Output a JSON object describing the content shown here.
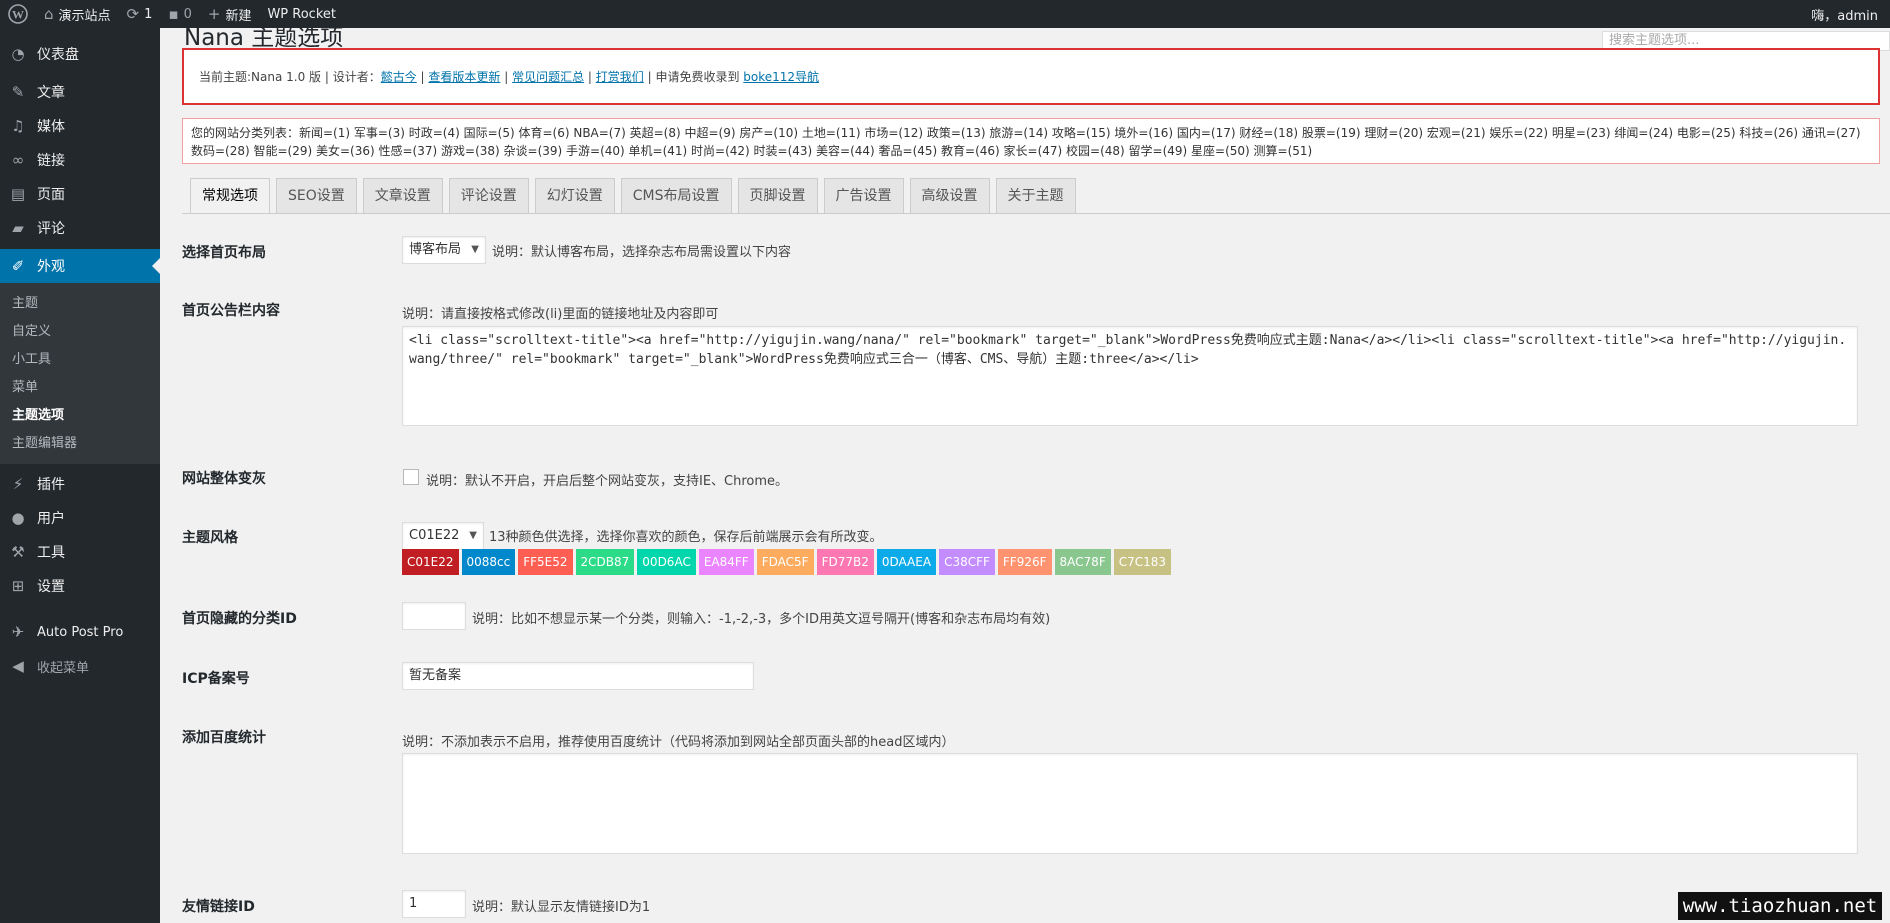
{
  "adminbar": {
    "site_name": "演示站点",
    "updates_count": "1",
    "comments_count": "0",
    "new_label": "新建",
    "rocket_label": "WP Rocket",
    "greeting": "嗨，admin"
  },
  "sidebar": {
    "items": [
      {
        "label": "仪表盘",
        "icon": "dashboard-icon"
      },
      {
        "label": "文章",
        "icon": "pin-icon"
      },
      {
        "label": "媒体",
        "icon": "media-icon"
      },
      {
        "label": "链接",
        "icon": "link-icon"
      },
      {
        "label": "页面",
        "icon": "page-icon"
      },
      {
        "label": "评论",
        "icon": "comment-icon"
      },
      {
        "label": "外观",
        "icon": "brush-icon"
      },
      {
        "label": "插件",
        "icon": "plugin-icon"
      },
      {
        "label": "用户",
        "icon": "user-icon"
      },
      {
        "label": "工具",
        "icon": "wrench-icon"
      },
      {
        "label": "设置",
        "icon": "settings-icon"
      },
      {
        "label": "Auto Post Pro",
        "icon": "auto-post-icon"
      },
      {
        "label": "收起菜单",
        "icon": "collapse-icon"
      }
    ],
    "appearance_submenu": [
      "主题",
      "自定义",
      "小工具",
      "菜单",
      "主题选项",
      "主题编辑器"
    ]
  },
  "page": {
    "title": "Nana 主题选项",
    "search_placeholder": "搜索主题选项..."
  },
  "notice": {
    "prefix": "当前主题:Nana 1.0 版 | 设计者：",
    "designer_link": "懿古今",
    "sep1": " | ",
    "update_link": "查看版本更新",
    "sep2": " | ",
    "faq_link": "常见问题汇总",
    "sep3": " | ",
    "donate_link": "打赏我们",
    "middle": " | 申请免费收录到 ",
    "nav_link": "boke112导航"
  },
  "categories_text": "您的网站分类列表：新闻=(1)  军事=(3)  时政=(4)  国际=(5)  体育=(6)  NBA=(7)  英超=(8)  中超=(9)  房产=(10)  土地=(11)  市场=(12)  政策=(13)  旅游=(14)  攻略=(15)  境外=(16)  国内=(17)  财经=(18)  股票=(19)  理财=(20)  宏观=(21)  娱乐=(22)  明星=(23)  绯闻=(24)  电影=(25)  科技=(26)  通讯=(27)  数码=(28)  智能=(29)  美女=(36)  性感=(37)  游戏=(38)  杂谈=(39)  手游=(40)  单机=(41)  时尚=(42)  时装=(43)  美容=(44)  奢品=(45)  教育=(46)  家长=(47)  校园=(48)  留学=(49)  星座=(50)  测算=(51)",
  "tabs": [
    "常规选项",
    "SEO设置",
    "文章设置",
    "评论设置",
    "幻灯设置",
    "CMS布局设置",
    "页脚设置",
    "广告设置",
    "高级设置",
    "关于主题"
  ],
  "fields": {
    "layout": {
      "label": "选择首页布局",
      "value": "博客布局",
      "desc": "说明：默认博客布局，选择杂志布局需设置以下内容"
    },
    "announcement": {
      "label": "首页公告栏内容",
      "desc": "说明：请直接按格式修改(li)里面的链接地址及内容即可",
      "value": "<li class=\"scrolltext-title\"><a href=\"http://yigujin.wang/nana/\" rel=\"bookmark\" target=\"_blank\">WordPress免费响应式主题:Nana</a></li><li class=\"scrolltext-title\"><a href=\"http://yigujin.wang/three/\" rel=\"bookmark\" target=\"_blank\">WordPress免费响应式三合一（博客、CMS、导航）主题:three</a></li>"
    },
    "grayscale": {
      "label": "网站整体变灰",
      "desc": "说明：默认不开启，开启后整个网站变灰，支持IE、Chrome。"
    },
    "theme_style": {
      "label": "主题风格",
      "value": "C01E22",
      "desc": "13种颜色供选择，选择你喜欢的颜色，保存后前端展示会有所改变。",
      "swatches": [
        {
          "label": "C01E22",
          "color": "#C01E22"
        },
        {
          "label": "0088cc",
          "color": "#0088cc"
        },
        {
          "label": "FF5E52",
          "color": "#FF5E52"
        },
        {
          "label": "2CDB87",
          "color": "#2CDB87"
        },
        {
          "label": "00D6AC",
          "color": "#00D6AC"
        },
        {
          "label": "EA84FF",
          "color": "#EA84FF"
        },
        {
          "label": "FDAC5F",
          "color": "#FDAC5F"
        },
        {
          "label": "FD77B2",
          "color": "#FD77B2"
        },
        {
          "label": "0DAAEA",
          "color": "#0DAAEA"
        },
        {
          "label": "C38CFF",
          "color": "#C38CFF"
        },
        {
          "label": "FF926F",
          "color": "#FF926F"
        },
        {
          "label": "8AC78F",
          "color": "#8AC78F"
        },
        {
          "label": "C7C183",
          "color": "#C7C183"
        }
      ]
    },
    "hidden_cats": {
      "label": "首页隐藏的分类ID",
      "value": "",
      "desc": "说明：比如不想显示某一个分类，则输入：-1,-2,-3，多个ID用英文逗号隔开(博客和杂志布局均有效)"
    },
    "icp": {
      "label": "ICP备案号",
      "value": "暂无备案"
    },
    "baidu": {
      "label": "添加百度统计",
      "desc": "说明：不添加表示不启用，推荐使用百度统计（代码将添加到网站全部页面头部的head区域内）",
      "value": ""
    },
    "friend_link": {
      "label": "友情链接ID",
      "value": "1",
      "desc": "说明：默认显示友情链接ID为1"
    }
  },
  "watermark": "www.tiaozhuan.net"
}
